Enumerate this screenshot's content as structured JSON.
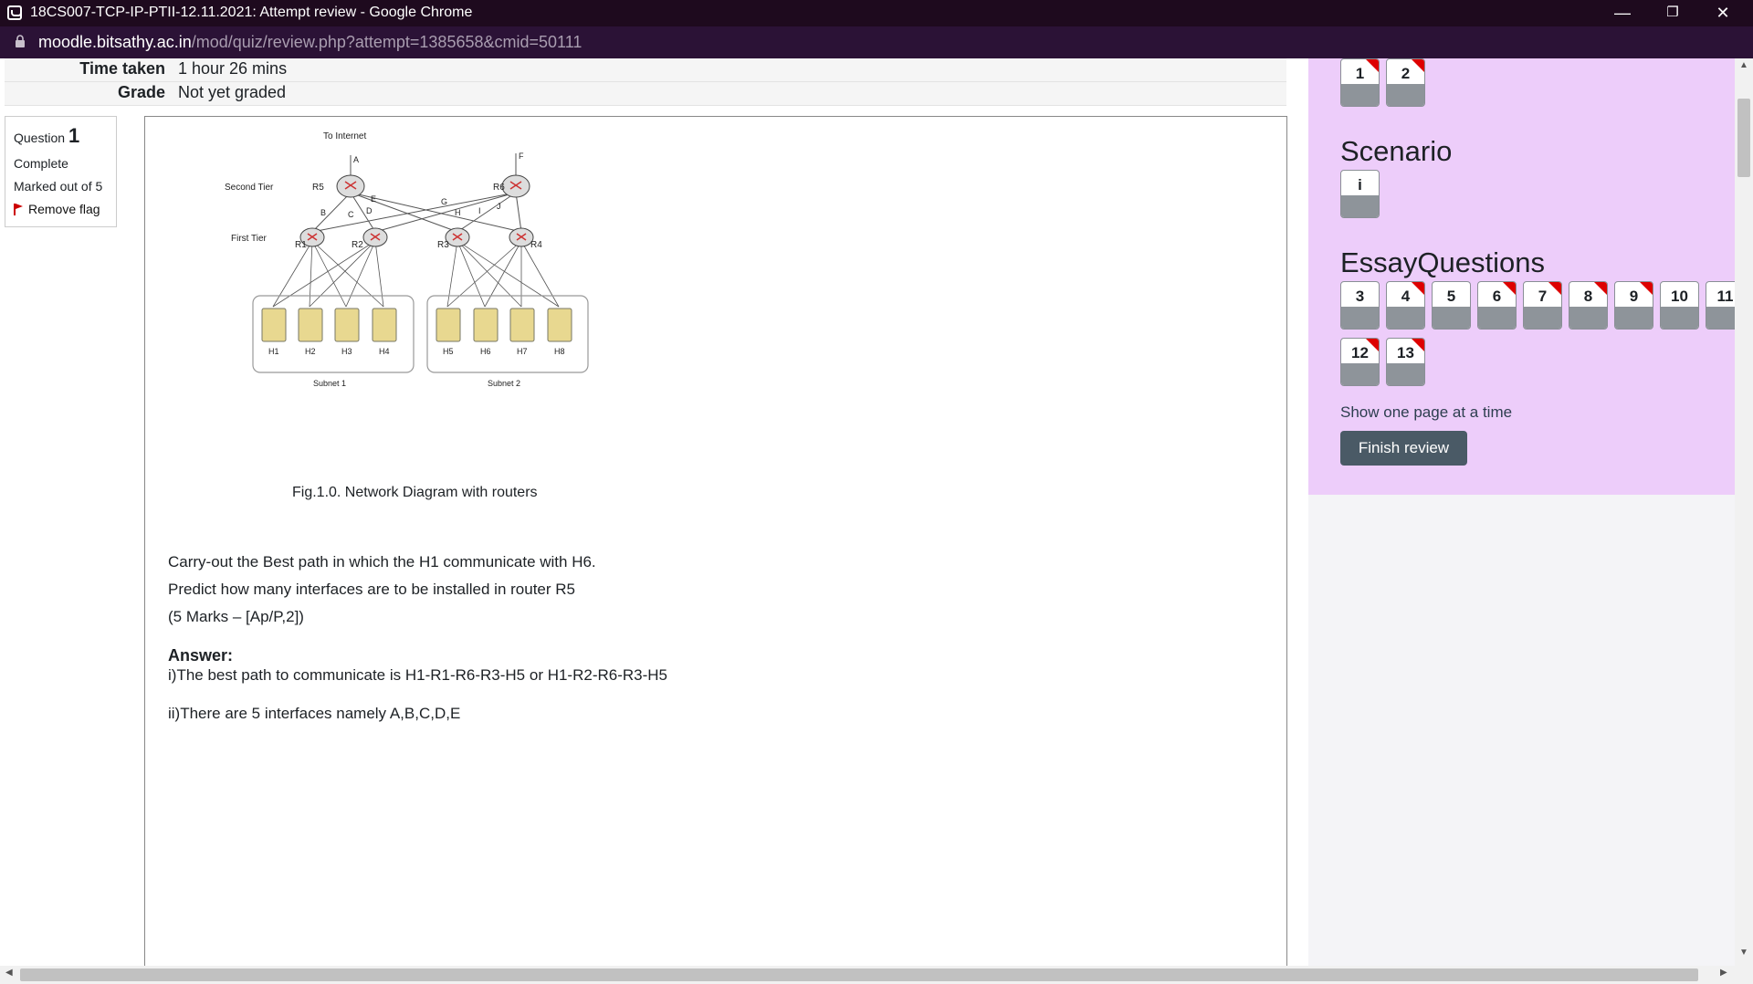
{
  "window": {
    "title": "18CS007-TCP-IP-PTII-12.11.2021: Attempt review - Google Chrome",
    "minimize": "—",
    "restore": "❐",
    "close": "✕"
  },
  "address": {
    "host": "moodle.bitsathy.ac.in",
    "path": "/mod/quiz/review.php?attempt=1385658&cmid=50111"
  },
  "summary": [
    {
      "label": "Time taken",
      "value": "1 hour 26 mins"
    },
    {
      "label": "Grade",
      "value": "Not yet graded"
    }
  ],
  "question_info": {
    "prefix": "Question",
    "number": "1",
    "state": "Complete",
    "marks": "Marked out of 5",
    "flag_label": "Remove flag"
  },
  "diagram": {
    "internet": "To Internet",
    "second_tier": "Second Tier",
    "first_tier": "First Tier",
    "routers": [
      "R5",
      "R6",
      "R1",
      "R2",
      "R3",
      "R4"
    ],
    "links": [
      "A",
      "F",
      "B",
      "C",
      "D",
      "E",
      "G",
      "H",
      "I",
      "J"
    ],
    "hosts": [
      "H1",
      "H2",
      "H3",
      "H4",
      "H5",
      "H6",
      "H7",
      "H8"
    ],
    "subnets": [
      "Subnet 1",
      "Subnet 2"
    ]
  },
  "question": {
    "caption": "Fig.1.0. Network Diagram with routers",
    "lines": [
      "Carry-out the Best path in which the H1 communicate with H6.",
      "Predict how many interfaces are to be installed in router R5",
      "(5 Marks – [Ap/P,2])"
    ],
    "answer_label": "Answer:",
    "answer_lines": [
      "i)The best path to communicate is H1-R1-R6-R3-H5 or H1-R2-R6-R3-H5",
      "ii)There are 5 interfaces namely A,B,C,D,E"
    ]
  },
  "navigation": {
    "top_buttons": [
      {
        "num": "1",
        "flagged": true
      },
      {
        "num": "2",
        "flagged": true
      }
    ],
    "scenario_heading": "Scenario",
    "scenario_buttons": [
      {
        "num": "i",
        "flagged": false
      }
    ],
    "essay_heading": "EssayQuestions",
    "essay_buttons": [
      {
        "num": "3",
        "flagged": false
      },
      {
        "num": "4",
        "flagged": true
      },
      {
        "num": "5",
        "flagged": false
      },
      {
        "num": "6",
        "flagged": true
      },
      {
        "num": "7",
        "flagged": true
      },
      {
        "num": "8",
        "flagged": true
      },
      {
        "num": "9",
        "flagged": true
      },
      {
        "num": "10",
        "flagged": false
      },
      {
        "num": "11",
        "flagged": false
      },
      {
        "num": "12",
        "flagged": true
      },
      {
        "num": "13",
        "flagged": true
      }
    ],
    "show_one_page": "Show one page at a time",
    "finish_review": "Finish review"
  },
  "colors": {
    "nav_background": "#edcdfa",
    "flag_red": "#dd0000",
    "finish_button": "#4a5a66"
  }
}
